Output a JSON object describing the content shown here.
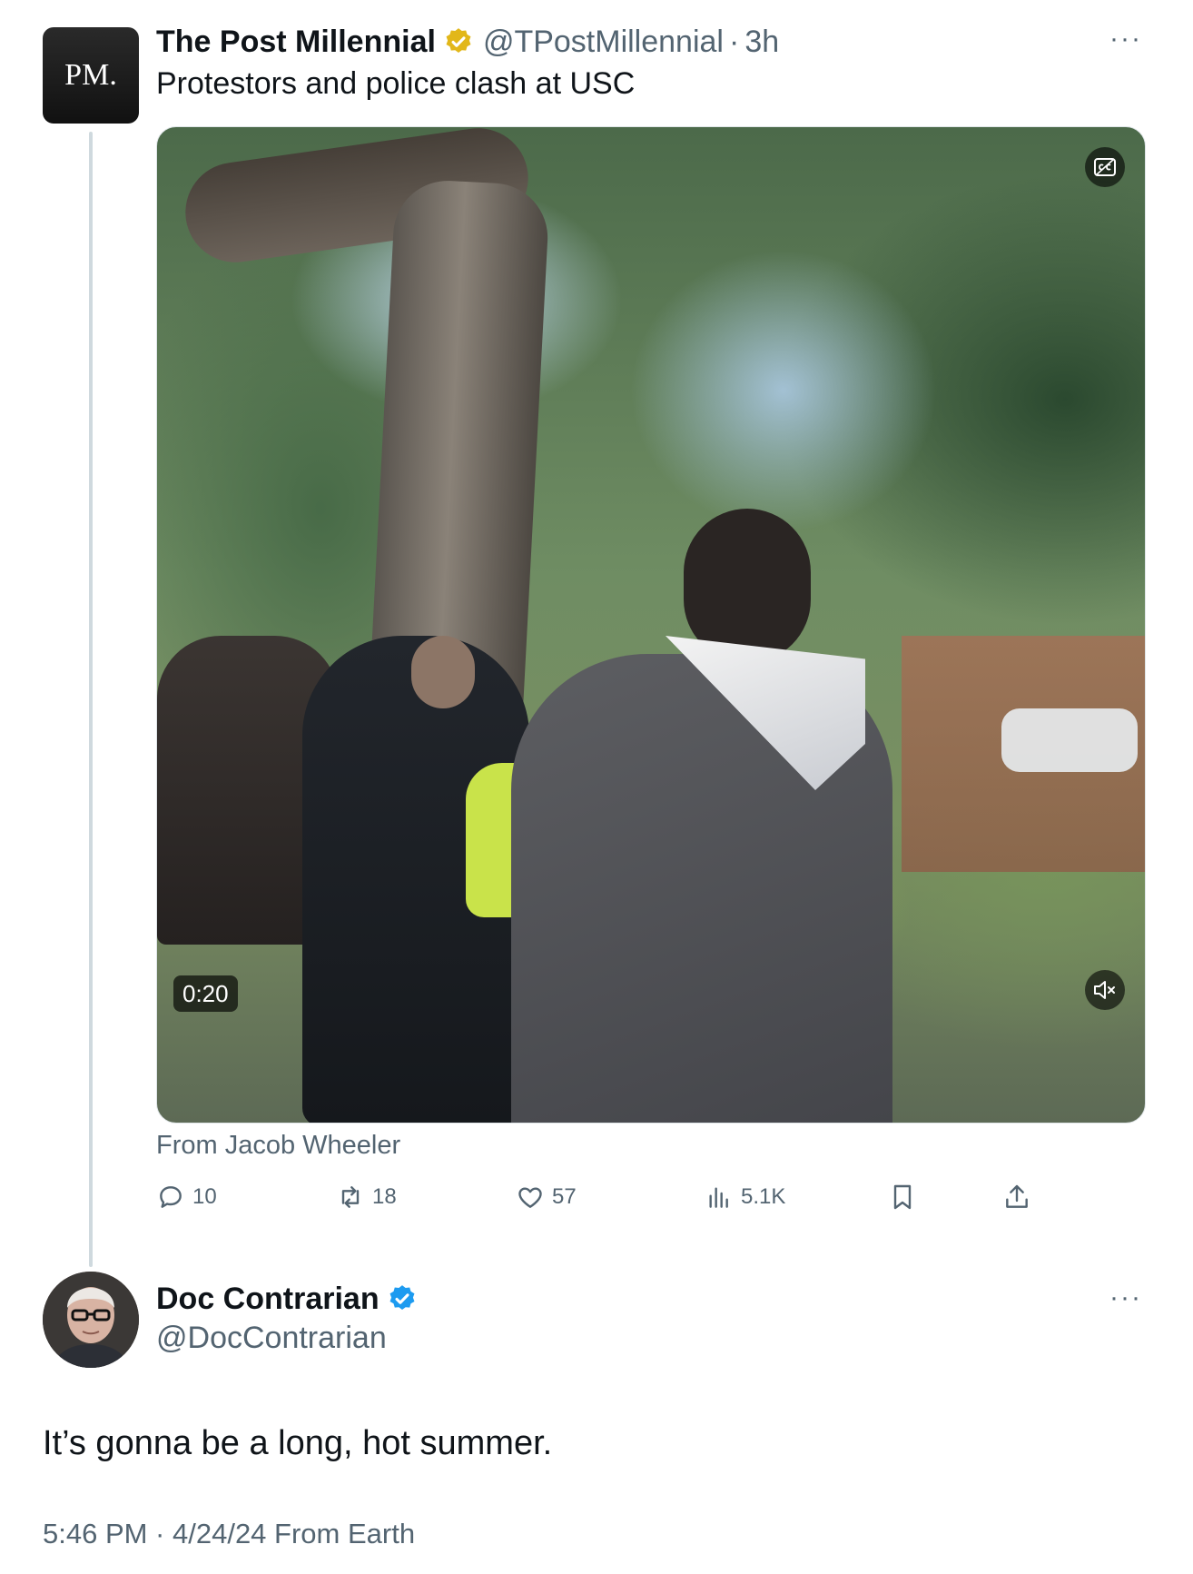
{
  "parent_tweet": {
    "avatar_text": "PM.",
    "display_name": "The Post Millennial",
    "verified_badge": "gold-verified-icon",
    "handle": "@TPostMillennial",
    "separator": "·",
    "time_ago": "3h",
    "more_menu": "···",
    "text": "Protestors and police clash at USC",
    "video": {
      "duration": "0:20",
      "captions_icon": "closed-captions-icon",
      "mute_icon": "muted-speaker-icon"
    },
    "attribution": "From Jacob Wheeler",
    "actions": {
      "replies": "10",
      "reposts": "18",
      "likes": "57",
      "views": "5.1K"
    }
  },
  "reply_tweet": {
    "display_name": "Doc Contrarian",
    "verified_badge": "blue-verified-icon",
    "handle": "@DocContrarian",
    "more_menu": "···",
    "text": "It’s gonna be a long, hot summer.",
    "meta": "5:46 PM · 4/24/24 From Earth"
  },
  "colors": {
    "text_primary": "#0f1419",
    "text_secondary": "#536471",
    "gold_badge": "#e2b719",
    "blue_badge": "#1d9bf0",
    "thread_line": "#cfd9de"
  }
}
